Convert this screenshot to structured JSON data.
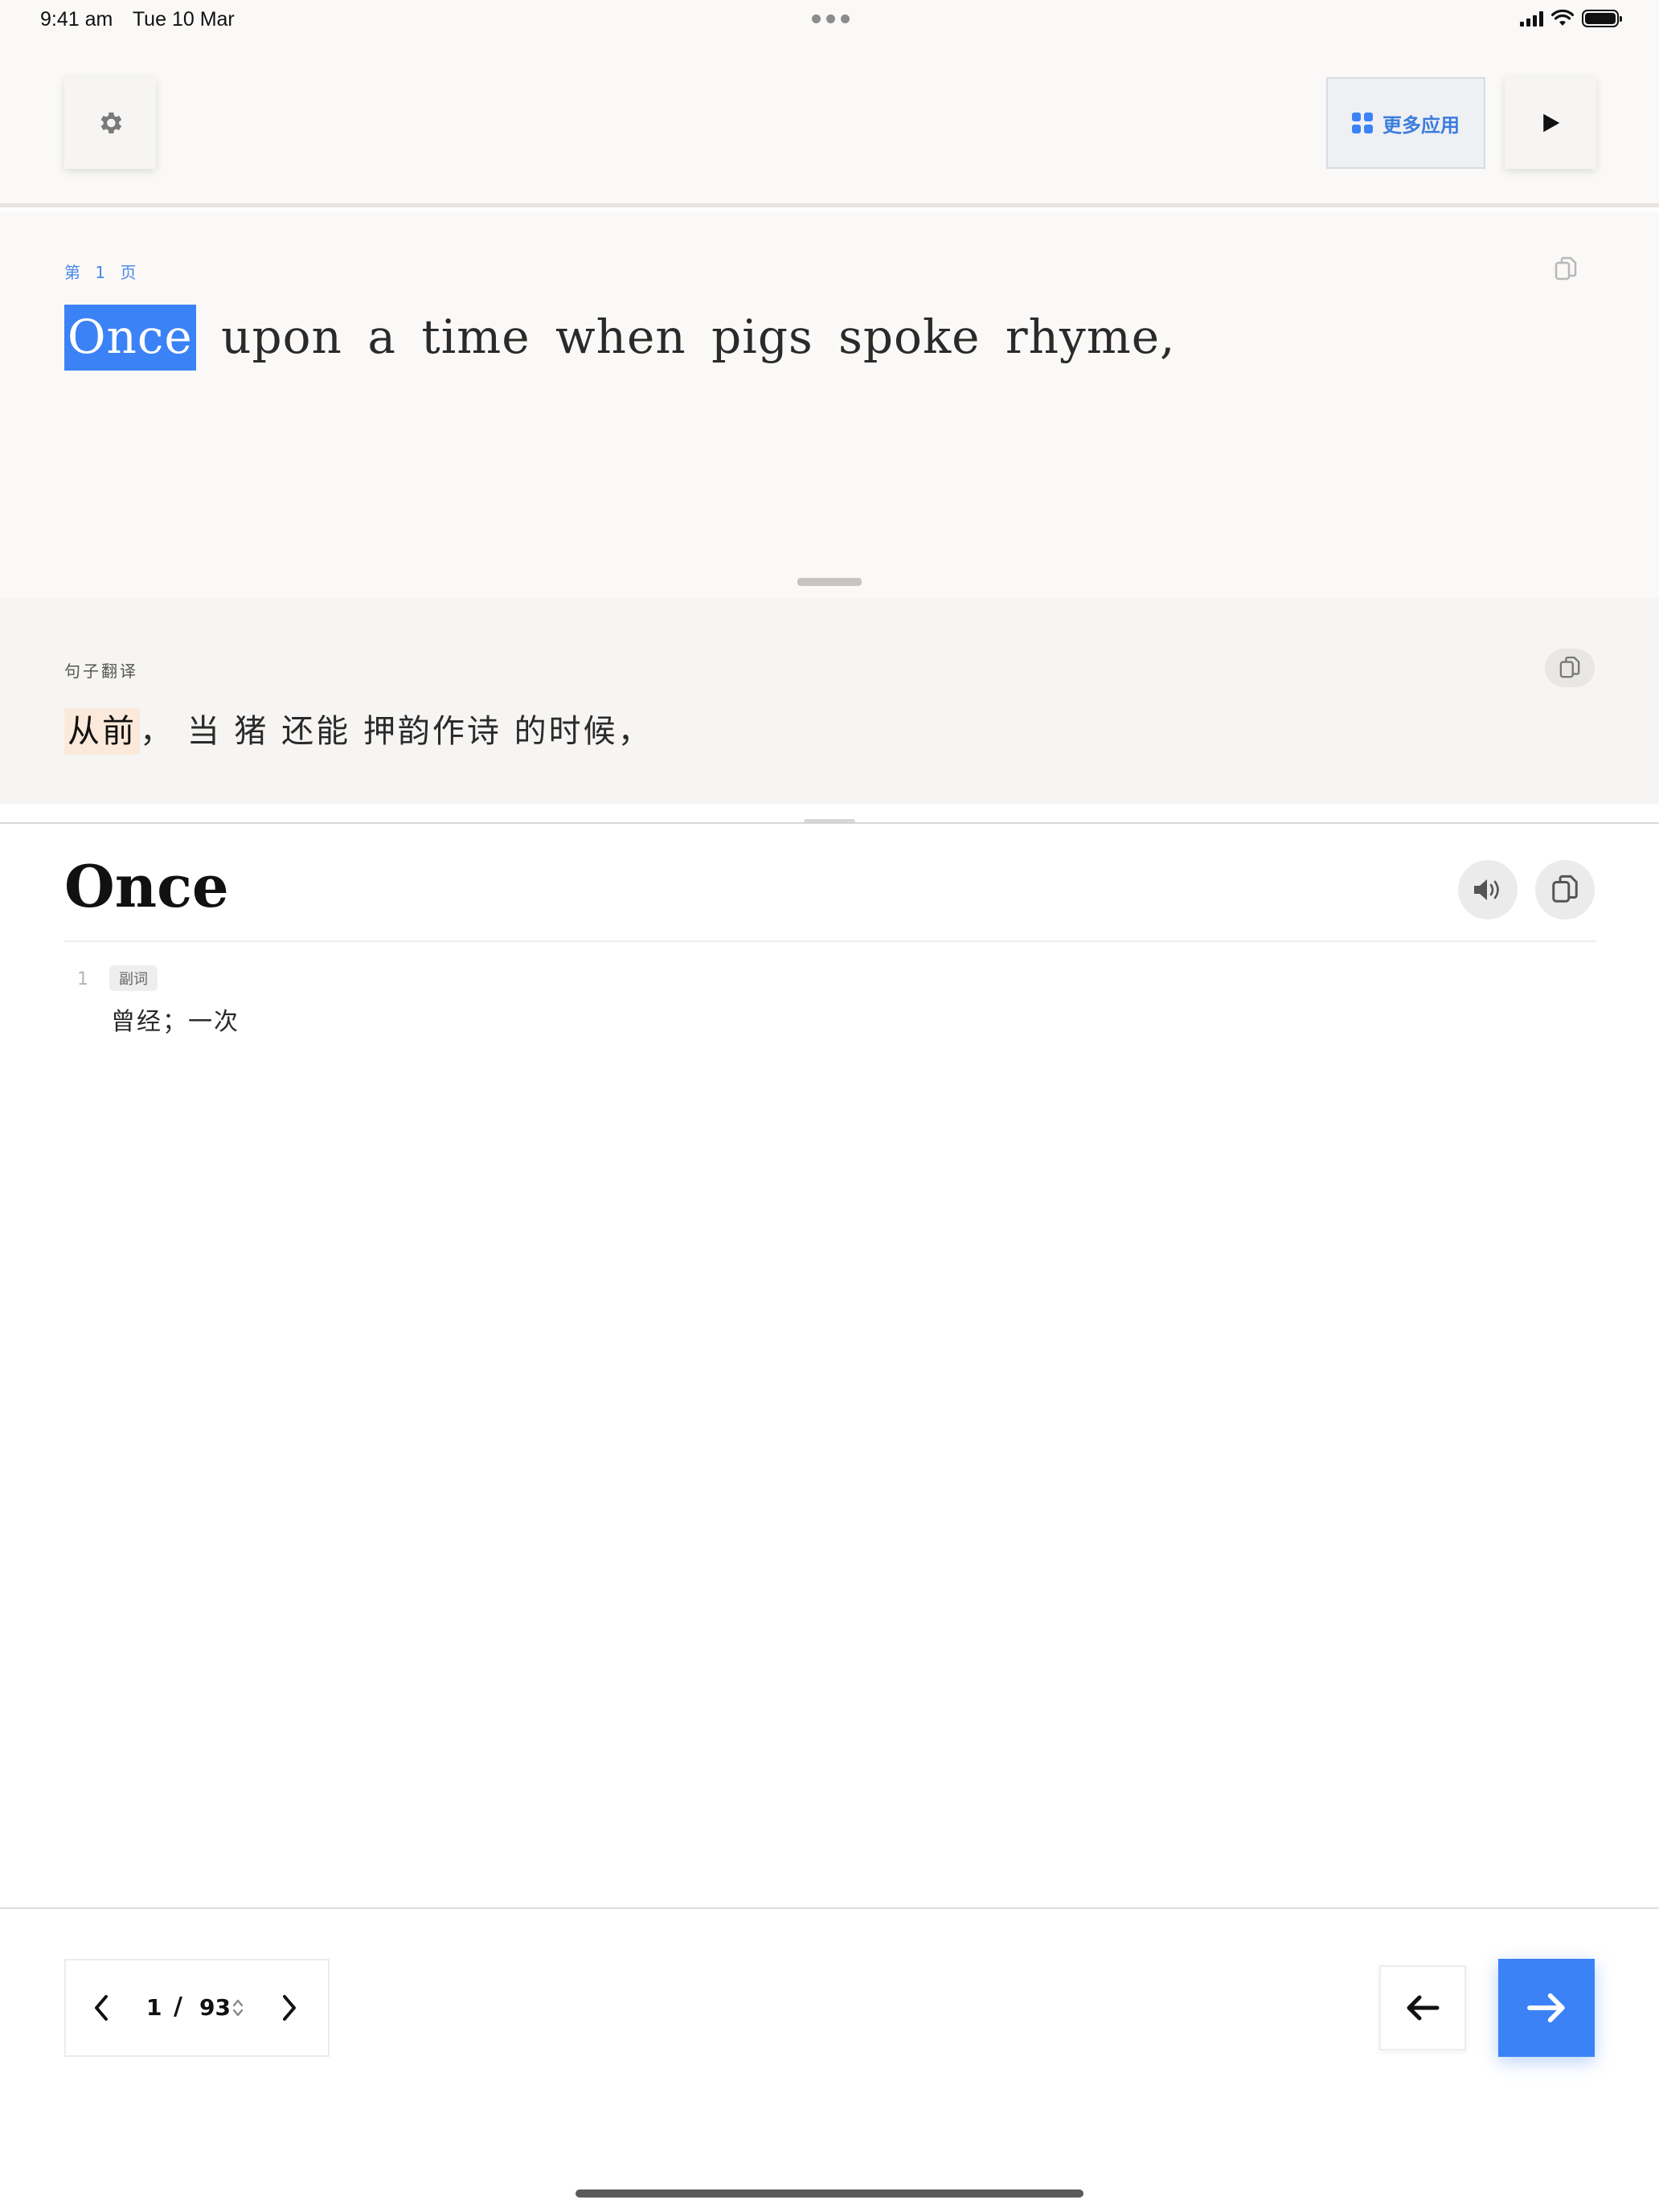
{
  "status_bar": {
    "time": "9:41 am",
    "date": "Tue 10 Mar"
  },
  "toolbar": {
    "settings_icon": "gear-icon",
    "more_apps_label": "更多应用",
    "more_apps_icon": "grid-icon",
    "play_icon": "play-icon",
    "accent": "#3b82f6"
  },
  "source": {
    "page_label": "第 1 页",
    "words": [
      "Once",
      "upon",
      "a",
      "time",
      "when",
      "pigs",
      "spoke",
      "rhyme,"
    ],
    "highlighted_index": 0
  },
  "translation": {
    "label": "句子翻译",
    "highlight": "从前",
    "rest": "， 当 猪 还能 押韵作诗 的时候，"
  },
  "dictionary": {
    "word": "Once",
    "definitions": [
      {
        "num": "1",
        "pos": "副词",
        "meaning": "曾经；一次"
      }
    ]
  },
  "pager": {
    "current": "1",
    "separator": "/",
    "total": "93"
  }
}
